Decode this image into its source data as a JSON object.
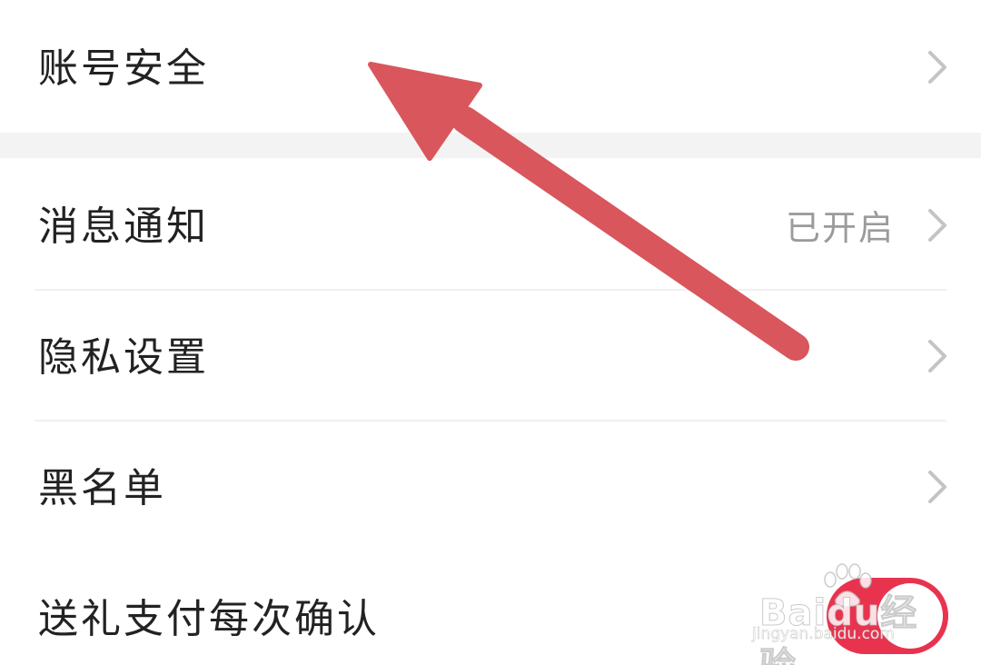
{
  "settings": {
    "items": [
      {
        "label": "账号安全"
      },
      {
        "label": "消息通知",
        "value": "已开启"
      },
      {
        "label": "隐私设置"
      },
      {
        "label": "黑名单"
      },
      {
        "label": "送礼支付每次确认",
        "toggle_on": true
      }
    ]
  },
  "colors": {
    "toggle_accent": "#e8334f",
    "annotation_arrow": "#d9565c"
  },
  "icons": {
    "row_chevron": "chevron-right-icon",
    "watermark_logo": "baidu-paw-icon"
  },
  "watermark": {
    "brand": "Baidu经验",
    "url": "jingyan.baidu.com"
  }
}
